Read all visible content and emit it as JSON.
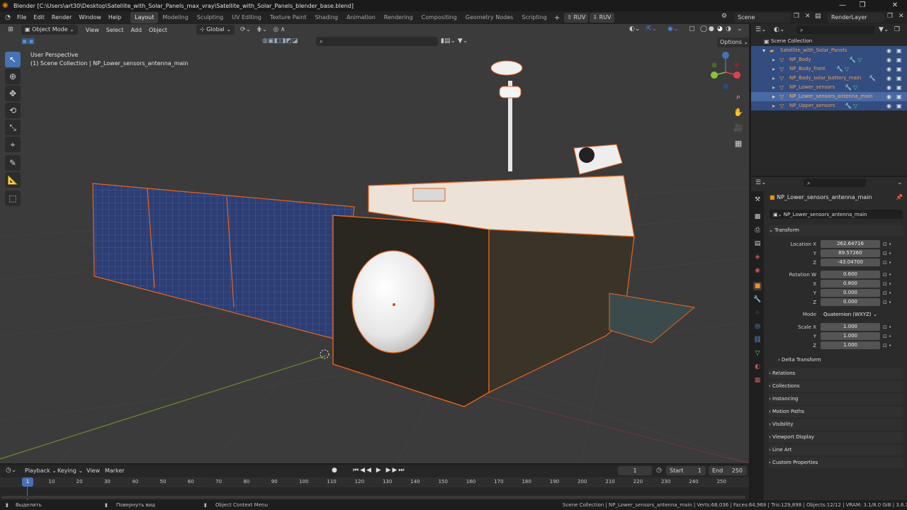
{
  "window": {
    "title": "Blender [C:\\Users\\art30\\Desktop\\Satellite_with_Solar_Panels_max_vray\\Satellite_with_Solar_Panels_blender_base.blend]",
    "controls": [
      "—",
      "❐",
      "✕"
    ]
  },
  "menubar": {
    "items": [
      "File",
      "Edit",
      "Render",
      "Window",
      "Help"
    ],
    "workspaces": [
      "Layout",
      "Modeling",
      "Sculpting",
      "UV Editing",
      "Texture Paint",
      "Shading",
      "Animation",
      "Rendering",
      "Compositing",
      "Geometry Nodes",
      "Scripting"
    ],
    "active_workspace": "Layout",
    "ruv1": "RUV",
    "ruv2": "RUV",
    "scene": "Scene",
    "view_layer": "RenderLayer"
  },
  "viewport": {
    "mode": "Object Mode",
    "menus": [
      "View",
      "Select",
      "Add",
      "Object"
    ],
    "transform_orientation": "Global",
    "options_label": "Options",
    "perspective": "User Perspective",
    "collection_info": "(1) Scene Collection | NP_Lower_sensors_antenna_main"
  },
  "outliner": {
    "root": "Scene Collection",
    "collection": "Satellite_with_Solar_Panels",
    "objects": [
      {
        "name": "NP_Body",
        "selected": false
      },
      {
        "name": "NP_Body_front",
        "selected": false
      },
      {
        "name": "NP_Body_solar_battery_main",
        "selected": false
      },
      {
        "name": "NP_Lower_sensors",
        "selected": false
      },
      {
        "name": "NP_Lower_sensors_antenna_main",
        "selected": true
      },
      {
        "name": "NP_Upper_sensors",
        "selected": false
      }
    ]
  },
  "properties": {
    "object_name": "NP_Lower_sensors_antenna_main",
    "object_field": "NP_Lower_sensors_antenna_main",
    "transform_label": "Transform",
    "location": {
      "label_x": "Location X",
      "x": "262.64716",
      "y": "89.57260",
      "z": "-43.04700"
    },
    "rotation": {
      "label_w": "Rotation W",
      "w": "0.600",
      "x": "0.800",
      "y": "0.000",
      "z": "0.000"
    },
    "mode_label": "Mode",
    "mode_value": "Quaternion (WXYZ)",
    "scale": {
      "label_x": "Scale X",
      "x": "1.000",
      "y": "1.000",
      "z": "1.000"
    },
    "axis_y": "Y",
    "axis_z": "Z",
    "axis_x": "X",
    "delta_transform": "Delta Transform",
    "panels": [
      "Relations",
      "Collections",
      "Instancing",
      "Motion Paths",
      "Visibility",
      "Viewport Display",
      "Line Art",
      "Custom Properties"
    ]
  },
  "timeline": {
    "menus": [
      "Playback",
      "Keying",
      "View",
      "Marker"
    ],
    "current_frame": "1",
    "start_label": "Start",
    "start": "1",
    "end_label": "End",
    "end": "250",
    "ticks": [
      "1",
      "10",
      "20",
      "30",
      "40",
      "50",
      "60",
      "70",
      "80",
      "90",
      "100",
      "110",
      "120",
      "130",
      "140",
      "150",
      "160",
      "170",
      "180",
      "190",
      "200",
      "210",
      "220",
      "230",
      "240",
      "250"
    ]
  },
  "statusbar": {
    "select": "Выделить",
    "rotate": "Повернуть вид",
    "context": "Object Context Menu",
    "stats": "Scene Collection | NP_Lower_sensors_antenna_main | Verts:68,036 | Faces:64,968 | Tris:129,898 | Objects:12/12 | VRAM: 3.1/8.0 GiB | 3.6.11"
  },
  "colors": {
    "accent": "#4772b3",
    "selection_orange": "#e87d0d",
    "outliner_selected": "#334d80",
    "viewport_bg": "#3b3b3b"
  }
}
